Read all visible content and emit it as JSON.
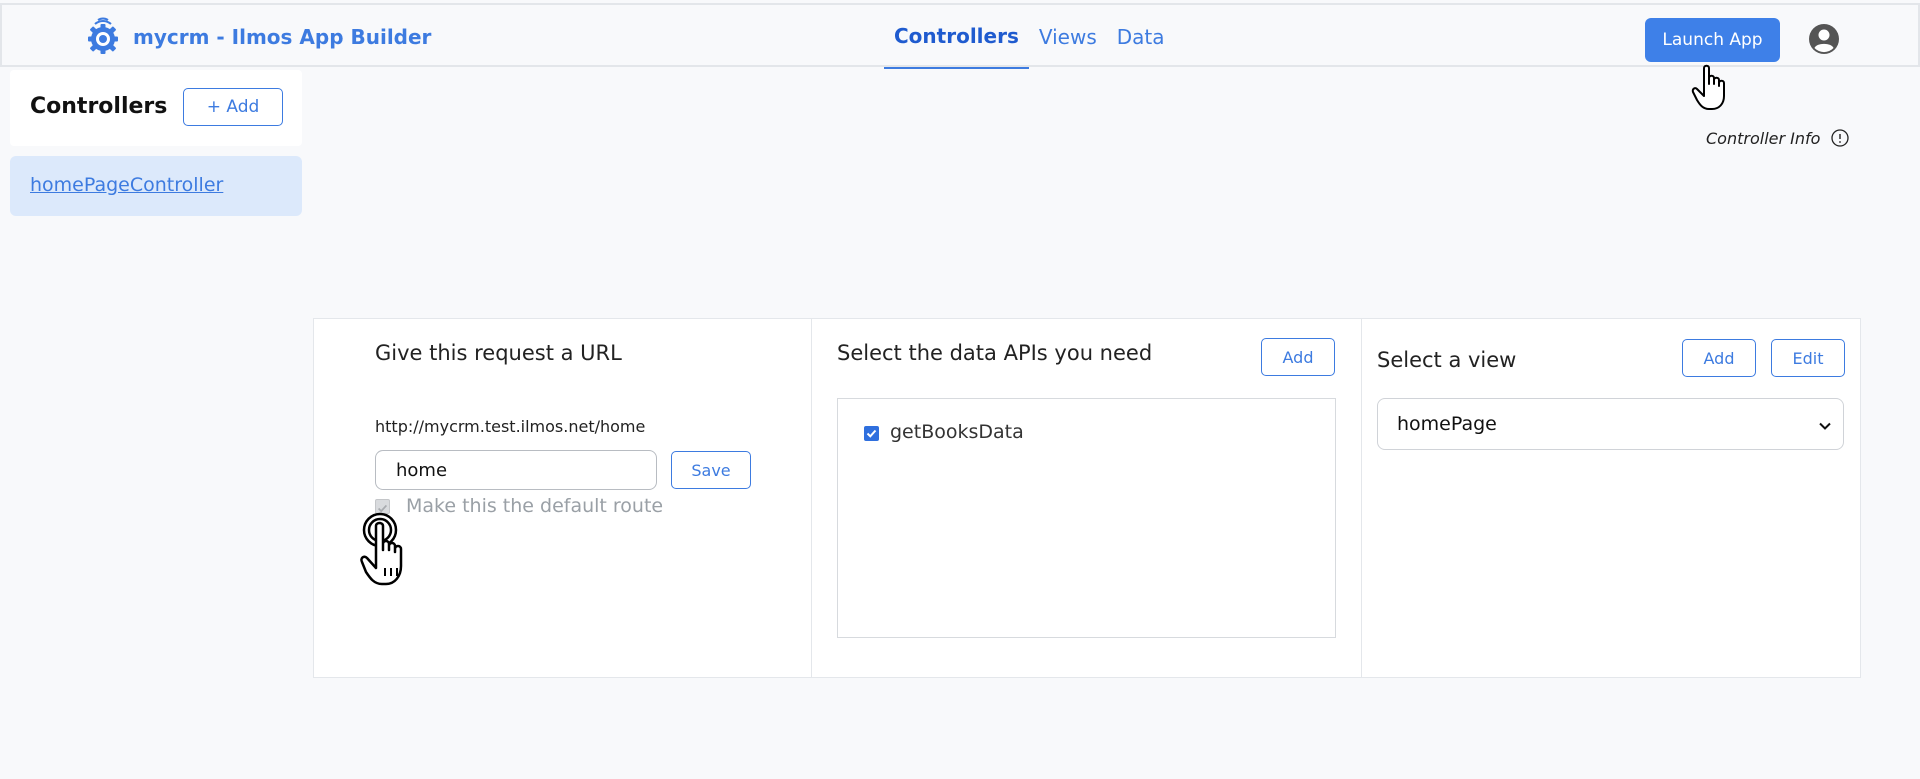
{
  "app": {
    "title": "mycrm - Ilmos App Builder",
    "logo_icon": "gear-signal-logo"
  },
  "nav": {
    "tabs": [
      {
        "label": "Controllers",
        "active": true
      },
      {
        "label": "Views",
        "active": false
      },
      {
        "label": "Data",
        "active": false
      }
    ]
  },
  "header": {
    "launch_label": "Launch App",
    "account_icon": "user-circle-icon"
  },
  "sidebar": {
    "title": "Controllers",
    "add_label": "+ Add",
    "items": [
      {
        "label": "homePageController",
        "selected": true
      }
    ]
  },
  "info": {
    "label": "Controller Info",
    "icon": "info-circle-icon"
  },
  "url_panel": {
    "title": "Give this request a URL",
    "url_prefix": "http://mycrm.test.ilmos.net/home",
    "input_value": "home",
    "save_label": "Save",
    "default_route_label": "Make this the default route",
    "default_route_checked": true,
    "default_route_disabled": true
  },
  "api_panel": {
    "title": "Select the data APIs you need",
    "add_label": "Add",
    "apis": [
      {
        "label": "getBooksData",
        "checked": true
      }
    ]
  },
  "view_panel": {
    "title": "Select a view",
    "add_label": "Add",
    "edit_label": "Edit",
    "selected_view": "homePage"
  },
  "colors": {
    "accent": "#3d7be0",
    "primary_button": "#3e80e8",
    "selected_item_bg": "#dce9fb",
    "page_bg": "#f8f9fb"
  }
}
